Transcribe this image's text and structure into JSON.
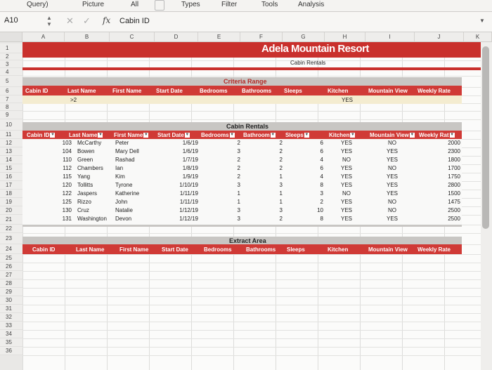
{
  "ribbon": [
    "Query)",
    "Picture",
    "All",
    "Types",
    "Filter",
    "Tools",
    "Analysis"
  ],
  "formula_bar": {
    "cell": "A10",
    "fx": "fx",
    "value": "Cabin ID"
  },
  "columns": [
    "A",
    "B",
    "C",
    "D",
    "E",
    "F",
    "G",
    "H",
    "I",
    "J",
    "K"
  ],
  "rows": [
    "1",
    "2",
    "3",
    "4",
    "5",
    "6",
    "7",
    "8",
    "9",
    "10",
    "11",
    "12",
    "13",
    "14",
    "15",
    "16",
    "17",
    "18",
    "19",
    "20",
    "21",
    "22",
    "23",
    "24",
    "25",
    "26",
    "27",
    "28",
    "29",
    "30",
    "31",
    "32",
    "33",
    "34",
    "35",
    "36"
  ],
  "title": "Adela Mountain Resort",
  "subtitle": "Cabin Rentals",
  "criteria": {
    "title": "Criteria Range",
    "headers": [
      "Cabin ID",
      "Last Name",
      "First Name",
      "Start Date",
      "Bedrooms",
      "Bathrooms",
      "Sleeps",
      "Kitchen",
      "Mountain View",
      "Weekly Rate"
    ],
    "values": [
      "",
      ">2",
      "",
      "",
      "",
      "",
      "",
      "YES",
      "",
      ""
    ]
  },
  "table": {
    "title": "Cabin Rentals",
    "headers": [
      "Cabin ID",
      "Last Name",
      "First Name",
      "Start Date",
      "Bedrooms",
      "Bathroom",
      "Sleeps",
      "Kitchen",
      "Mountain View",
      "Weekly Rat"
    ],
    "rows": [
      [
        "103",
        "McCarthy",
        "Peter",
        "1/6/19",
        "2",
        "2",
        "6",
        "YES",
        "NO",
        "2000"
      ],
      [
        "104",
        "Bowen",
        "Mary Dell",
        "1/6/19",
        "3",
        "2",
        "6",
        "YES",
        "YES",
        "2300"
      ],
      [
        "110",
        "Green",
        "Rashad",
        "1/7/19",
        "2",
        "2",
        "4",
        "NO",
        "YES",
        "1800"
      ],
      [
        "112",
        "Chambers",
        "Ian",
        "1/8/19",
        "2",
        "2",
        "6",
        "YES",
        "NO",
        "1700"
      ],
      [
        "115",
        "Yang",
        "Kim",
        "1/9/19",
        "2",
        "1",
        "4",
        "YES",
        "YES",
        "1750"
      ],
      [
        "120",
        "Tollitts",
        "Tyrone",
        "1/10/19",
        "3",
        "3",
        "8",
        "YES",
        "YES",
        "2800"
      ],
      [
        "122",
        "Jaspers",
        "Katherine",
        "1/11/19",
        "1",
        "1",
        "3",
        "NO",
        "YES",
        "1500"
      ],
      [
        "125",
        "Rizzo",
        "John",
        "1/11/19",
        "1",
        "1",
        "2",
        "YES",
        "NO",
        "1475"
      ],
      [
        "130",
        "Cruz",
        "Natalie",
        "1/12/19",
        "3",
        "3",
        "10",
        "YES",
        "NO",
        "2500"
      ],
      [
        "131",
        "Washington",
        "Devon",
        "1/12/19",
        "3",
        "2",
        "8",
        "YES",
        "YES",
        "2500"
      ]
    ]
  },
  "extract": {
    "title": "Extract Area",
    "headers": [
      "Cabin ID",
      "Last Name",
      "First Name",
      "Start Date",
      "Bedrooms",
      "Bathrooms",
      "Sleeps",
      "Kitchen",
      "Mountain View",
      "Weekly Rate"
    ]
  },
  "colors": {
    "red": "#c9302c",
    "header_red": "#d03a36",
    "criteria_tan": "#f4ecd0",
    "grey_band": "#c8c6c3"
  }
}
